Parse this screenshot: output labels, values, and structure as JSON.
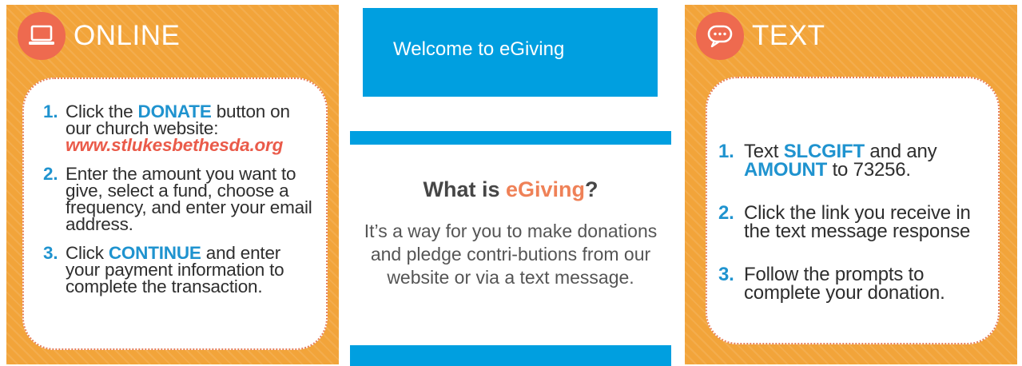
{
  "online": {
    "title": "ONLINE",
    "icon": "laptop-icon",
    "steps": [
      {
        "num": "1.",
        "pre": "Click the ",
        "keyword": "DONATE",
        "post": " button on our church website:",
        "url": "www.stlukesbethesda.org"
      },
      {
        "num": "2.",
        "text": "Enter the amount you want to give, select a fund, choose a frequency, and enter your email address."
      },
      {
        "num": "3.",
        "pre": "Click ",
        "keyword": "CONTINUE",
        "post": " and enter your payment information to complete the transaction."
      }
    ]
  },
  "center": {
    "welcome": "Welcome to eGiving",
    "question_pre": "What is ",
    "question_highlight": "eGiving",
    "question_post": "?",
    "description": "It’s a way for you to make donations and pledge contri-butions from our website or via a text message."
  },
  "text": {
    "title": "TEXT",
    "icon": "chat-bubble-icon",
    "steps": [
      {
        "num": "1.",
        "pre": "Text ",
        "keyword1": "SLCGIFT",
        "mid": " and any ",
        "keyword2": "AMOUNT",
        "post": " to 73256."
      },
      {
        "num": "2.",
        "text": "Click the link you receive in the text message response"
      },
      {
        "num": "3.",
        "text": "Follow the prompts to complete your donation."
      }
    ]
  },
  "colors": {
    "orange_panel": "#f2a43a",
    "blue": "#009fe0",
    "accent_coral": "#ee6a4f",
    "step_blue": "#1f93cf"
  }
}
